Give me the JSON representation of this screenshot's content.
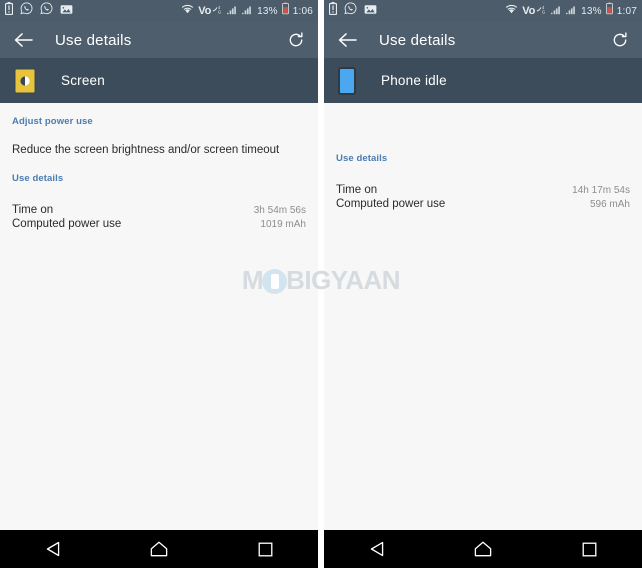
{
  "watermark": {
    "pre": "M",
    "post": "BIGYAAN",
    "logo_icon": "mobigyaan-circle-logo"
  },
  "panels": [
    {
      "statusbar": {
        "left_icons": [
          "battery-alert-icon",
          "whatsapp-icon",
          "whatsapp-icon",
          "photo-icon"
        ],
        "right_icons": [
          "wifi-icon",
          "volte-icon",
          "signal-bars-icon",
          "signal-bars-icon",
          "battery-icon"
        ],
        "volte_label": "Vo",
        "battery_percent": "13%",
        "clock": "1:06"
      },
      "toolbar": {
        "back_icon": "back-arrow-icon",
        "title": "Use details",
        "refresh_icon": "refresh-icon"
      },
      "app_header": {
        "icon": "screen-brightness-icon",
        "icon_color": "#e8c33c",
        "label": "Screen"
      },
      "sections": {
        "adjust_header": "Adjust power use",
        "adjust_body": "Reduce the screen brightness and/or screen timeout",
        "details_header": "Use details",
        "rows": [
          {
            "key": "Time on",
            "value": "3h 54m 56s"
          },
          {
            "key": "Computed power use",
            "value": "1019 mAh"
          }
        ]
      },
      "navbar": {
        "back": "nav-back-icon",
        "home": "nav-home-icon",
        "recents": "nav-recents-icon"
      }
    },
    {
      "statusbar": {
        "left_icons": [
          "battery-alert-icon",
          "whatsapp-icon",
          "photo-icon"
        ],
        "right_icons": [
          "wifi-icon",
          "volte-icon",
          "signal-bars-icon",
          "signal-bars-icon",
          "battery-icon"
        ],
        "volte_label": "Vo",
        "battery_percent": "13%",
        "clock": "1:07"
      },
      "toolbar": {
        "back_icon": "back-arrow-icon",
        "title": "Use details",
        "refresh_icon": "refresh-icon"
      },
      "app_header": {
        "icon": "phone-idle-icon",
        "icon_color": "#4aa7f0",
        "label": "Phone idle"
      },
      "sections": {
        "details_header": "Use details",
        "rows": [
          {
            "key": "Time on",
            "value": "14h 17m 54s"
          },
          {
            "key": "Computed power use",
            "value": "596 mAh"
          }
        ]
      },
      "navbar": {
        "back": "nav-back-icon",
        "home": "nav-home-icon",
        "recents": "nav-recents-icon"
      }
    }
  ],
  "colors": {
    "statusbar_bg": "#4c5c6b",
    "toolbar_bg": "#4e5e6d",
    "apphdr_bg": "#3d4c5a",
    "content_bg": "#f7f7f7",
    "accent_blue": "#4a7db0",
    "navbar_bg": "#000000"
  }
}
